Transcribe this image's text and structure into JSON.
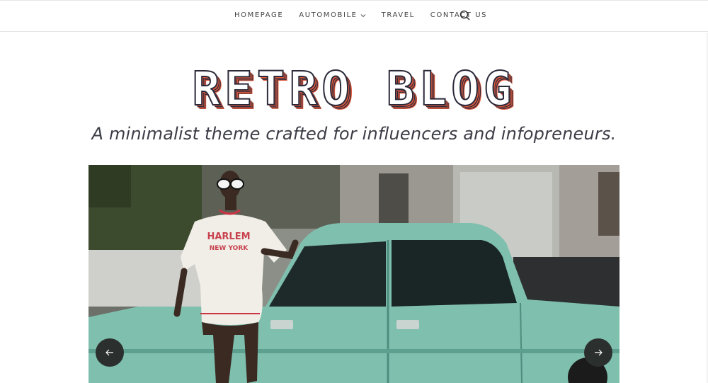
{
  "nav": {
    "items": [
      {
        "label": "HOMEPAGE",
        "has_dropdown": false
      },
      {
        "label": "AUTOMOBILE",
        "has_dropdown": true
      },
      {
        "label": "TRAVEL",
        "has_dropdown": false
      },
      {
        "label": "CONTACT US",
        "has_dropdown": false
      }
    ],
    "search_icon": "search-icon",
    "dropdown_icon": "chevron-down-icon"
  },
  "brand": {
    "title": "RETRO BLOG",
    "tagline": "A minimalist theme crafted for influencers and infopreneurs.",
    "colors": {
      "stripe_dark": "#2b2a3a",
      "stripe_accent": "#e35a3d"
    }
  },
  "hero": {
    "shirt_text_line1": "HARLEM",
    "shirt_text_line2": "NEW YORK",
    "prev_icon": "arrow-left-icon",
    "next_icon": "arrow-right-icon",
    "car_color": "#7fbfae"
  },
  "colors": {
    "nav_text": "#444444",
    "background": "#ffffff"
  }
}
